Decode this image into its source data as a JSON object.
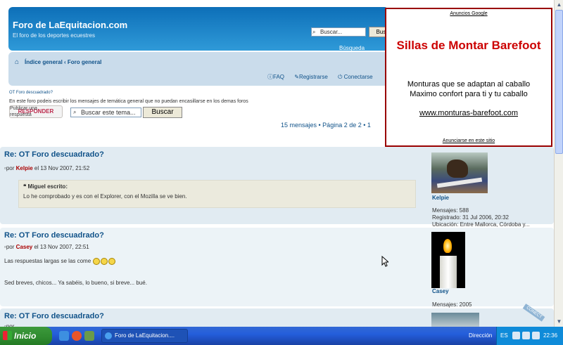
{
  "header": {
    "site_title": "Foro de LaEquitacion.com",
    "site_desc": "El foro de los deportes ecuestres",
    "search_placeholder": "Buscar...",
    "search_button": "Buscar",
    "advanced_search": "Búsqueda avanzada"
  },
  "nav": {
    "breadcrumb": "Índice general ‹ Foro general",
    "faq": "FAQ",
    "register": "Registrarse",
    "login": "Conectarse"
  },
  "topic": {
    "title": "OT Foro descuadrado?",
    "description": "En este foro podeis escribir los mensajes de temática general que no puedan encasillarse en los demas foros",
    "reply_button": "RESPONDER",
    "reply_overlay": "Publicar una respuesta",
    "search_placeholder": "Buscar este tema...",
    "search_button": "Buscar",
    "pagination": "15 mensajes • Página 2 de 2 • 1"
  },
  "ad": {
    "label": "Anuncios Google",
    "title": "Sillas de Montar Barefoot",
    "text_line1": "Monturas que se adaptan al caballo",
    "text_line2": "Maximo confort para ti y tu caballo",
    "url": "www.monturas-barefoot.com",
    "footer": "Anunciarse en este sitio"
  },
  "posts": [
    {
      "title": "Re: OT Foro descuadrado?",
      "meta_prefix": "por",
      "author": "Kelpie",
      "date": "el 13 Nov 2007, 21:52",
      "quote_author": "Miguel escrito:",
      "quote_text": "Lo he comprobado y es con el Explorer, con el Mozilla se ve bien.",
      "username": "Kelpie",
      "stats_line1": "Mensajes: 588",
      "stats_line2": "Registrado: 31 Jul 2006, 20:32",
      "stats_line3": "Ubicación: Entre Mallorca, Córdoba y..."
    },
    {
      "title": "Re: OT Foro descuadrado?",
      "meta_prefix": "por",
      "author": "Casey",
      "date": "el 13 Nov 2007, 22:51",
      "text1": "Las respuestas largas se las come",
      "text2": "Sed breves, chicos... Ya sabéis, lo bueno, si breve... bué.",
      "username": "Casey",
      "stats_line1": "Mensajes: 2005"
    },
    {
      "title": "Re: OT Foro descuadrado?",
      "meta_prefix": "por",
      "author": "",
      "date": "",
      "ribbon": "CONECT"
    }
  ],
  "taskbar": {
    "start": "Inicio",
    "task_item": "Foro de LaEquitacion....",
    "address": "Dirección",
    "lang": "ES",
    "clock": "22:36"
  }
}
